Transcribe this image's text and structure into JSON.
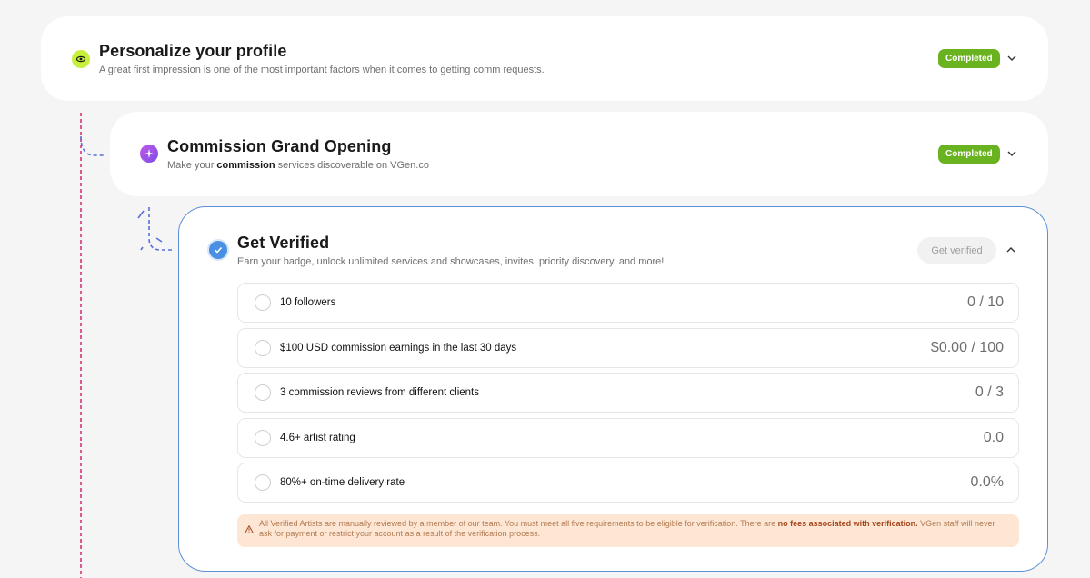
{
  "cards": [
    {
      "title": "Personalize your profile",
      "description": "A great first impression is one of the most important factors when it comes to getting comm requests.",
      "badge": "Completed",
      "icon": "eye-icon"
    },
    {
      "title": "Commission Grand Opening",
      "description_prefix": "Make your ",
      "description_bold": "commission",
      "description_suffix": " services discoverable on VGen.co",
      "badge": "Completed",
      "icon": "sparkle-icon"
    },
    {
      "title": "Get Verified",
      "description": "Earn your badge, unlock unlimited services and showcases, invites, priority discovery, and more!",
      "button": "Get verified",
      "icon": "check-circle-icon"
    }
  ],
  "requirements": [
    {
      "label": "10 followers",
      "value": "0 / 10"
    },
    {
      "label": "$100 USD commission earnings in the last 30 days",
      "value": "$0.00 / 100"
    },
    {
      "label": "3 commission reviews from different clients",
      "value": "0 / 3"
    },
    {
      "label": "4.6+ artist rating",
      "value": "0.0"
    },
    {
      "label": "80%+ on-time delivery rate",
      "value": "0.0%"
    }
  ],
  "notice": {
    "text": "All Verified Artists are manually reviewed by a member of our team. You must meet all five requirements to be eligible for verification. There are ",
    "bold": "no fees associated with verification.",
    "suffix": " VGen staff will never ask for payment or restrict your account as a result of the verification process."
  },
  "colors": {
    "badge": "#6ab320",
    "accent_blue": "#5b8fd8",
    "connector_pink": "#d6337a",
    "connector_blue": "#5a6fd6",
    "notice_bg": "#fde6d4"
  }
}
